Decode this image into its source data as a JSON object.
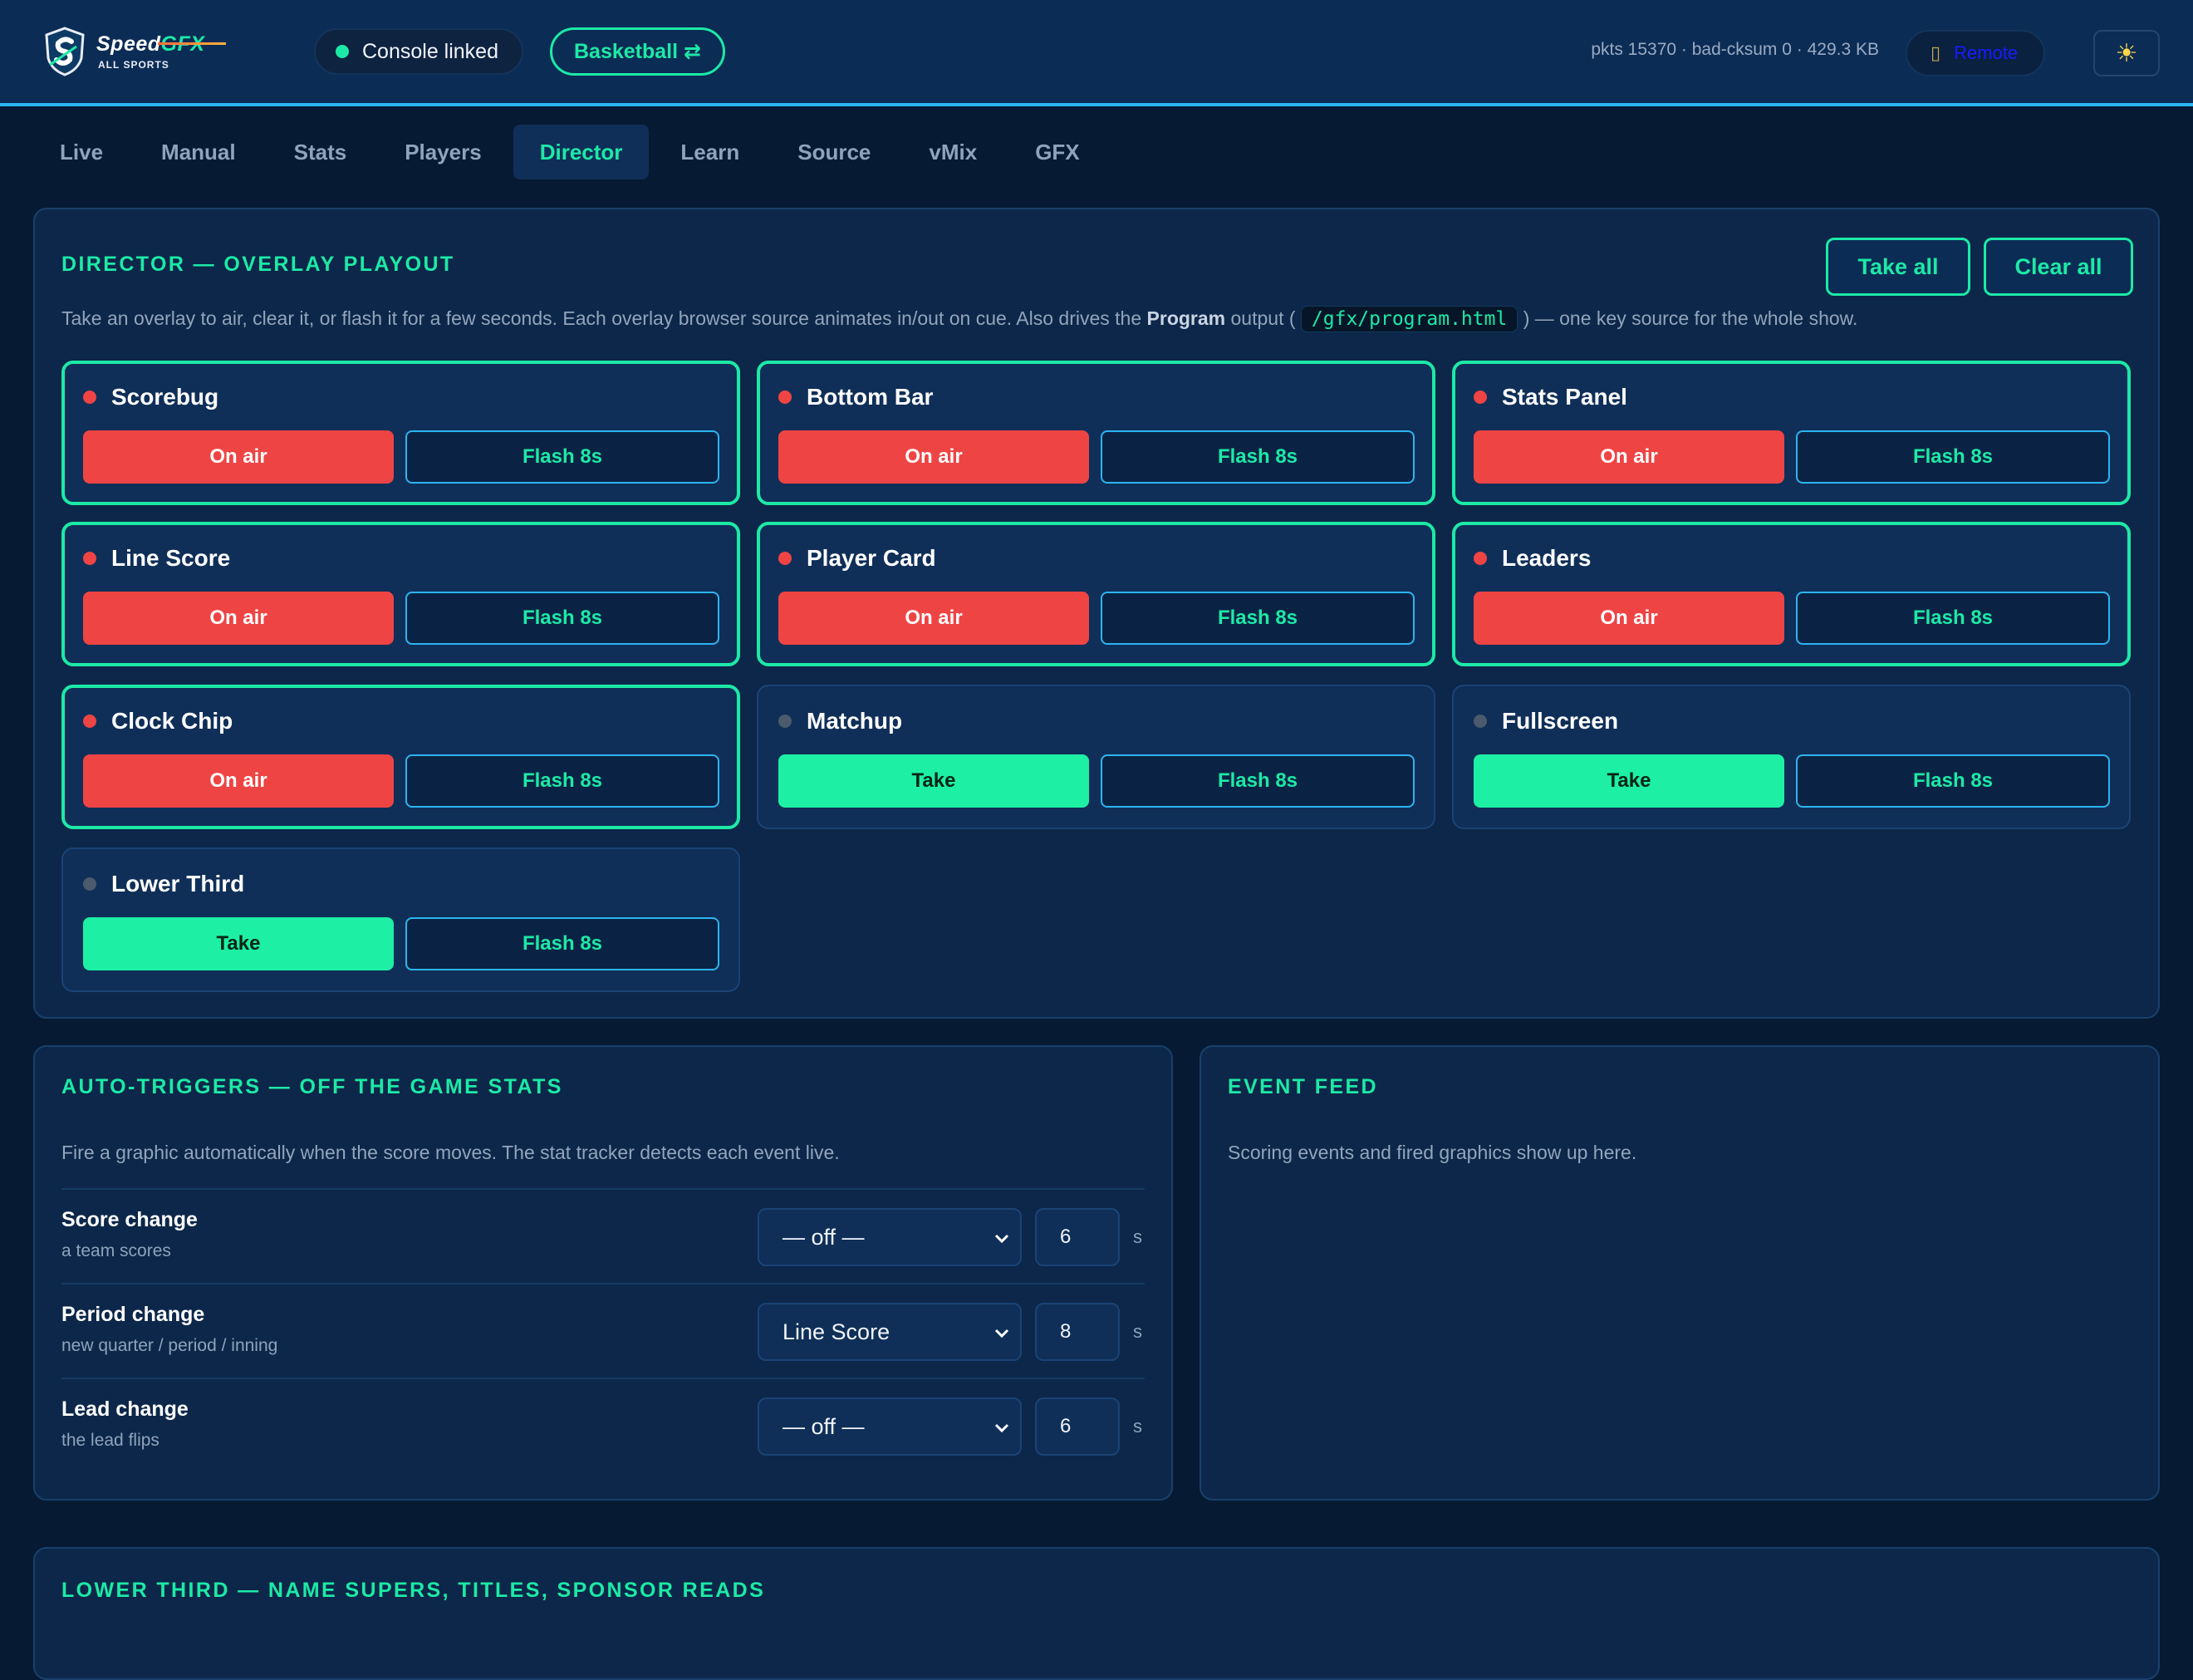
{
  "app": {
    "brand_main": "Speed",
    "brand_accent": "GFX",
    "brand_sub": "ALL SPORTS",
    "link_status": "Console linked",
    "sport": "Basketball ⇄",
    "stats": "pkts 15370 · bad-cksum 0 · 429.3 KB",
    "remote_label": "Remote",
    "theme_icon": "sun-icon",
    "colors": {
      "accent": "#1de9a6",
      "on_air": "#ef4444",
      "panel": "#0c2749",
      "link": "#2db4f0"
    }
  },
  "tabs": [
    {
      "label": "Live"
    },
    {
      "label": "Manual"
    },
    {
      "label": "Stats"
    },
    {
      "label": "Players"
    },
    {
      "label": "Director",
      "active": true
    },
    {
      "label": "Learn"
    },
    {
      "label": "Source"
    },
    {
      "label": "vMix"
    },
    {
      "label": "GFX"
    }
  ],
  "director": {
    "title": "DIRECTOR — OVERLAY PLAYOUT",
    "take_all": "Take all",
    "clear_all": "Clear all",
    "desc_pre": "Take an overlay to air, clear it, or flash it for a few seconds. Each overlay browser source animates in/out on cue. Also drives the ",
    "desc_bold": "Program",
    "desc_mid": " output ( ",
    "desc_code": "/gfx/program.html",
    "desc_post": " ) — one key source for the whole show.",
    "overlays": [
      {
        "name": "Scorebug",
        "on_air": true,
        "take_label": "On air",
        "flash_label": "Flash 8s"
      },
      {
        "name": "Bottom Bar",
        "on_air": true,
        "take_label": "On air",
        "flash_label": "Flash 8s"
      },
      {
        "name": "Stats Panel",
        "on_air": true,
        "take_label": "On air",
        "flash_label": "Flash 8s"
      },
      {
        "name": "Line Score",
        "on_air": true,
        "take_label": "On air",
        "flash_label": "Flash 8s"
      },
      {
        "name": "Player Card",
        "on_air": true,
        "take_label": "On air",
        "flash_label": "Flash 8s"
      },
      {
        "name": "Leaders",
        "on_air": true,
        "take_label": "On air",
        "flash_label": "Flash 8s"
      },
      {
        "name": "Clock Chip",
        "on_air": true,
        "take_label": "On air",
        "flash_label": "Flash 8s"
      },
      {
        "name": "Matchup",
        "on_air": false,
        "take_label": "Take",
        "flash_label": "Flash 8s"
      },
      {
        "name": "Fullscreen",
        "on_air": false,
        "take_label": "Take",
        "flash_label": "Flash 8s"
      },
      {
        "name": "Lower Third",
        "on_air": false,
        "take_label": "Take",
        "flash_label": "Flash 8s"
      }
    ]
  },
  "auto_triggers": {
    "title": "AUTO-TRIGGERS — OFF THE GAME STATS",
    "desc": "Fire a graphic automatically when the score moves. The stat tracker detects each event live.",
    "unit": "s",
    "rows": [
      {
        "label": "Score change",
        "sub": "a team scores",
        "selected": "— off —",
        "seconds": "6"
      },
      {
        "label": "Period change",
        "sub": "new quarter / period / inning",
        "selected": "Line Score",
        "seconds": "8"
      },
      {
        "label": "Lead change",
        "sub": "the lead flips",
        "selected": "— off —",
        "seconds": "6"
      }
    ]
  },
  "event_feed": {
    "title": "EVENT FEED",
    "empty": "Scoring events and fired graphics show up here."
  },
  "lower_third": {
    "title": "LOWER THIRD — NAME SUPERS, TITLES, SPONSOR READS"
  }
}
